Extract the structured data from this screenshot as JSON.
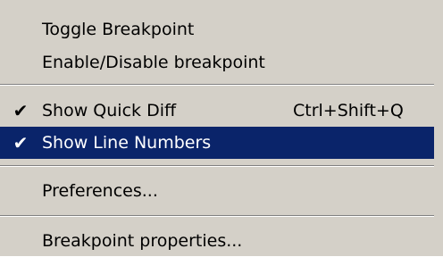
{
  "menu": {
    "items": [
      {
        "label": "Toggle Breakpoint",
        "shortcut": "",
        "checked": false
      },
      {
        "label": "Enable/Disable breakpoint",
        "shortcut": "",
        "checked": false
      },
      {
        "label": "Show Quick Diff",
        "shortcut": "Ctrl+Shift+Q",
        "checked": true,
        "check_glyph": "✔"
      },
      {
        "label": "Show Line Numbers",
        "shortcut": "",
        "checked": true,
        "check_glyph": "✔",
        "selected": true
      },
      {
        "label": "Preferences...",
        "shortcut": "",
        "checked": false
      },
      {
        "label": "Breakpoint properties...",
        "shortcut": "",
        "checked": false
      }
    ],
    "colors": {
      "background": "#d4d0c8",
      "selected_background": "#0a246a",
      "selected_text": "#ffffff",
      "text": "#000000"
    }
  }
}
